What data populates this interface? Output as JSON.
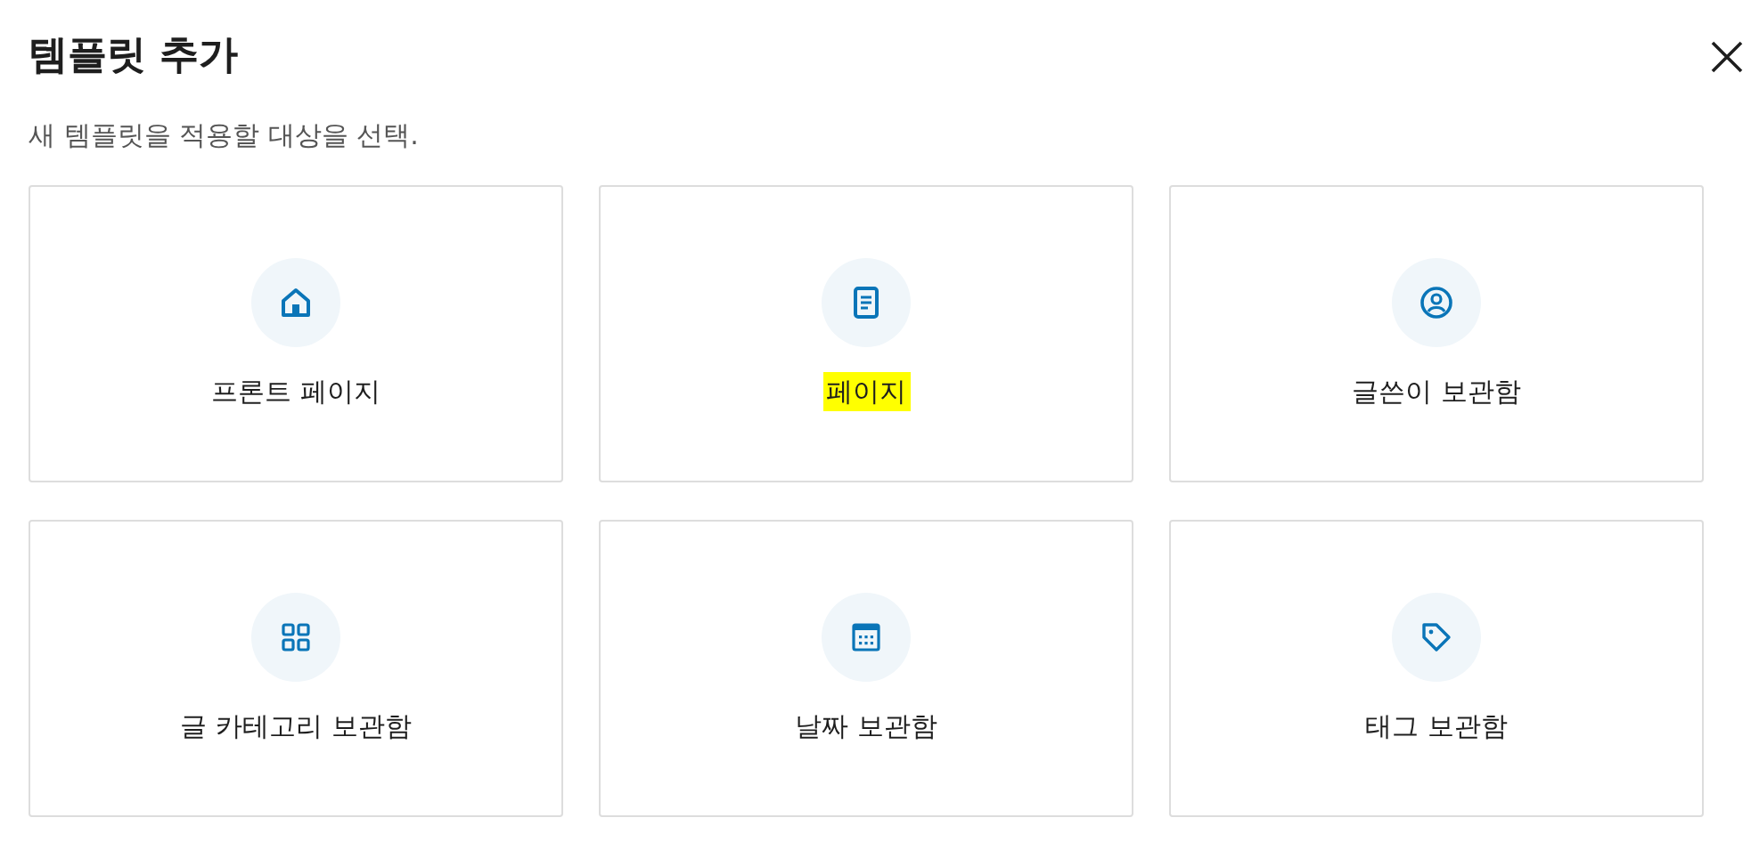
{
  "dialog": {
    "title": "템플릿 추가",
    "subtitle": "새 템플릿을 적용할 대상을 선택."
  },
  "options": [
    {
      "label": "프론트 페이지",
      "kind": "home",
      "highlighted": false
    },
    {
      "label": "페이지",
      "kind": "page",
      "highlighted": true
    },
    {
      "label": "글쓴이 보관함",
      "kind": "author",
      "highlighted": false
    },
    {
      "label": "글 카테고리 보관함",
      "kind": "category",
      "highlighted": false
    },
    {
      "label": "날짜 보관함",
      "kind": "date",
      "highlighted": false
    },
    {
      "label": "태그 보관함",
      "kind": "tag",
      "highlighted": false
    }
  ]
}
